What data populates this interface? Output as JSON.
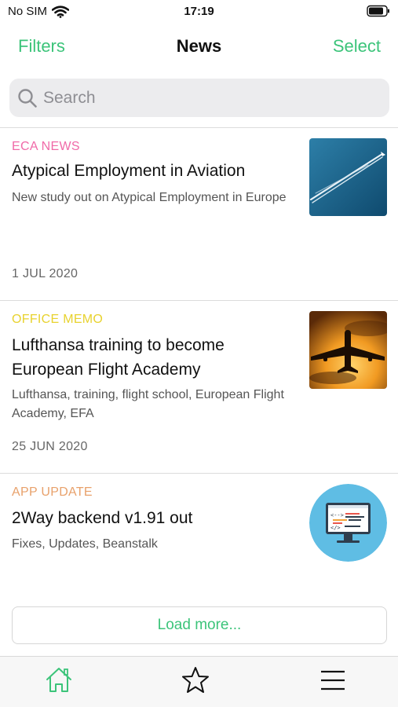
{
  "status_bar": {
    "carrier": "No SIM",
    "time": "17:19"
  },
  "nav": {
    "left": "Filters",
    "title": "News",
    "right": "Select"
  },
  "search": {
    "placeholder": "Search"
  },
  "articles": [
    {
      "category": "ECA NEWS",
      "category_color": "#f06aa8",
      "title": "Atypical Employment in Aviation",
      "summary": "New study out on Atypical Employment in Europe",
      "date": "1 JUL 2020",
      "image_icon": "contrail-sky-image"
    },
    {
      "category": "OFFICE MEMO",
      "category_color": "#e8d22e",
      "title": "Lufthansa training to become European Flight Academy",
      "summary": "Lufthansa, training, flight school, European Flight Academy, EFA",
      "date": "25 JUN 2020",
      "image_icon": "airplane-sunset-image"
    },
    {
      "category": "APP UPDATE",
      "category_color": "#e8a16b",
      "title": "2Way backend v1.91 out",
      "summary": "Fixes, Updates, Beanstalk",
      "date": "",
      "image_icon": "code-monitor-image"
    }
  ],
  "load_more": "Load more...",
  "tabbar": {
    "items": [
      "home-icon",
      "star-icon",
      "menu-icon"
    ],
    "active_color": "#3cc47a"
  },
  "colors": {
    "accent": "#3cc47a"
  }
}
